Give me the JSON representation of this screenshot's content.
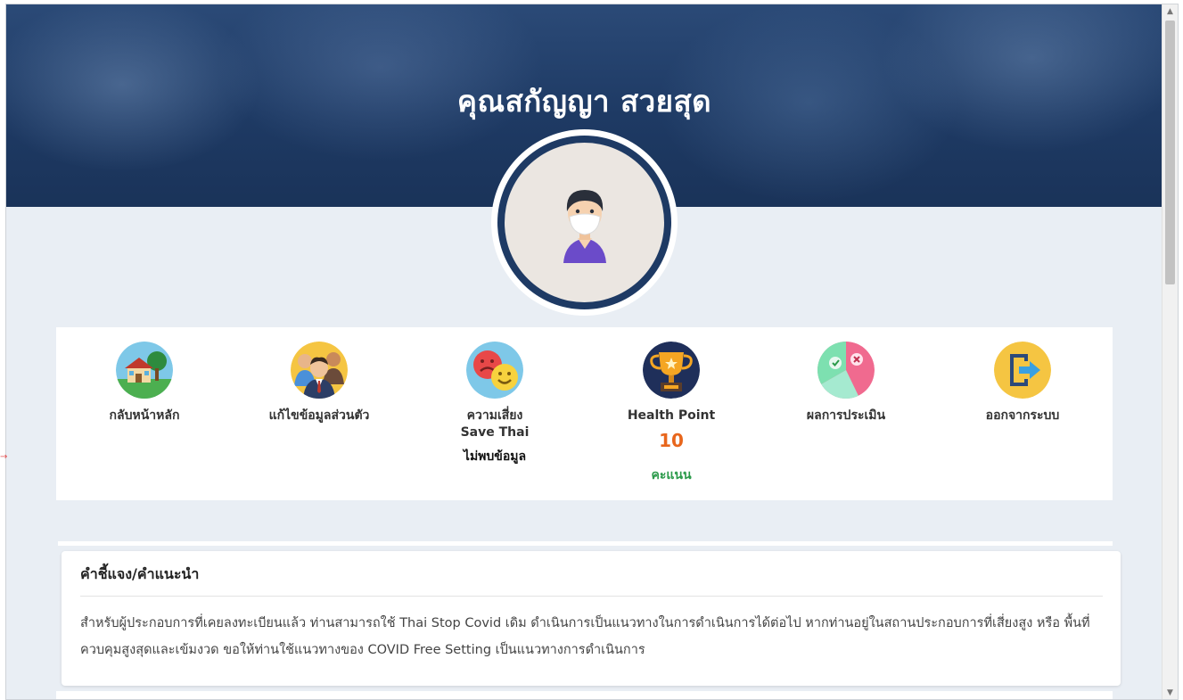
{
  "profile": {
    "name": "คุณสกัญญา สวยสุด"
  },
  "menu": {
    "home": {
      "label": "กลับหน้าหลัก"
    },
    "edit_profile": {
      "label": "แก้ไขข้อมูลส่วนตัว"
    },
    "risk": {
      "label": "ความเสี่ยง",
      "sublabel": "Save Thai",
      "status": "ไม่พบข้อมูล"
    },
    "health_point": {
      "label": "Health Point",
      "value": "10",
      "unit": "คะแนน"
    },
    "assessment": {
      "label": "ผลการประเมิน"
    },
    "logout": {
      "label": "ออกจากระบบ"
    }
  },
  "info": {
    "title": "คำชี้แจง/คำแนะนำ",
    "body": "สำหรับผู้ประกอบการที่เคยลงทะเบียนแล้ว ท่านสามารถใช้ Thai Stop Covid เดิม ดำเนินการเป็นแนวทางในการดำเนินการได้ต่อไป หากท่านอยู่ในสถานประกอบการที่เสี่ยงสูง หรือ พื้นที่ควบคุมสูงสุดและเข้มงวด ขอให้ท่านใช้แนวทางของ COVID Free Setting เป็นแนวทางการดำเนินการ"
  },
  "colors": {
    "hero": "#1e3a64",
    "points": "#e8661c",
    "points_unit": "#2b9a4a",
    "page_bg": "#e9eef4"
  },
  "icons": [
    "house-icon",
    "people-icon",
    "risk-faces-icon",
    "trophy-icon",
    "assessment-chart-icon",
    "logout-icon",
    "user-avatar-icon"
  ]
}
